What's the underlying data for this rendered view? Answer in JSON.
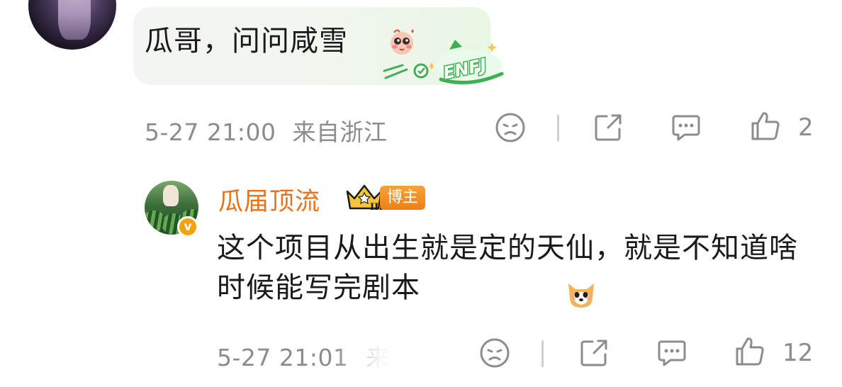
{
  "comment": {
    "text": "瓜哥，问问咸雪",
    "timestamp": "5-27 21:00",
    "location": "来自浙江",
    "like_count": "2",
    "badge_text": "ENFJ"
  },
  "reply": {
    "username": "瓜届顶流",
    "tag": "博主",
    "crown_level": "III",
    "verified_mark": "v",
    "text": "这个项目从出生就是定的天仙，就是不知道啥时候能写完剧本",
    "timestamp": "5-27 21:01",
    "location_partial": "来",
    "like_count": "12"
  },
  "colors": {
    "username": "#e8731a",
    "meta_gray": "#8c8c8c",
    "tag_orange": "#ef7f14",
    "verified_gold": "#f2a10f",
    "badge_green": "#3fae55"
  },
  "icons": [
    "dislike-face-icon",
    "share-icon",
    "comment-icon",
    "like-icon",
    "crown-icon",
    "verified-icon",
    "doge-emoji-icon",
    "blushing-emoji-icon"
  ]
}
